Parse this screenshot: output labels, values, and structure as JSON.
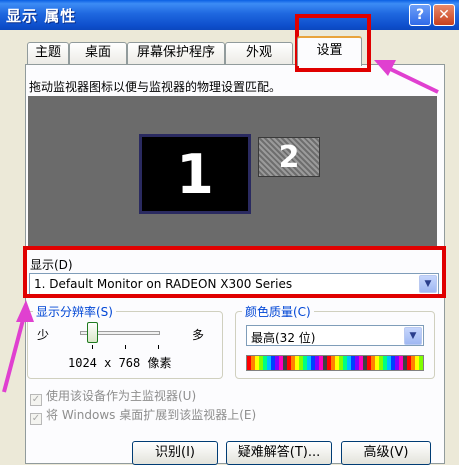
{
  "window": {
    "title": "显示 属性"
  },
  "tabs": [
    {
      "label": "主题"
    },
    {
      "label": "桌面"
    },
    {
      "label": "屏幕保护程序"
    },
    {
      "label": "外观"
    },
    {
      "label": "设置"
    }
  ],
  "active_tab": "设置",
  "settings": {
    "description": "拖动监视器图标以便与监视器的物理设置匹配。",
    "monitors": [
      {
        "number": "1"
      },
      {
        "number": "2"
      }
    ],
    "display": {
      "label": "显示(D)",
      "selected": "1. Default Monitor on RADEON X300 Series"
    },
    "resolution": {
      "label": "显示分辨率(S)",
      "min_label": "少",
      "max_label": "多",
      "value": "1024 x 768 像素"
    },
    "color_quality": {
      "label": "颜色质量(C)",
      "selected": "最高(32 位)"
    },
    "checkboxes": [
      {
        "label": "使用该设备作为主监视器(U)",
        "checked": true,
        "enabled": false
      },
      {
        "label": "将 Windows 桌面扩展到该监视器上(E)",
        "checked": true,
        "enabled": false
      }
    ],
    "buttons": [
      {
        "label": "识别(I)"
      },
      {
        "label": "疑难解答(T)..."
      },
      {
        "label": "高级(V)"
      }
    ]
  },
  "colors": {
    "annotation_red": "#E00000",
    "annotation_arrow": "#E040D0",
    "titlebar_blue": "#0E4FCC",
    "group_label_blue": "#0046D5"
  }
}
